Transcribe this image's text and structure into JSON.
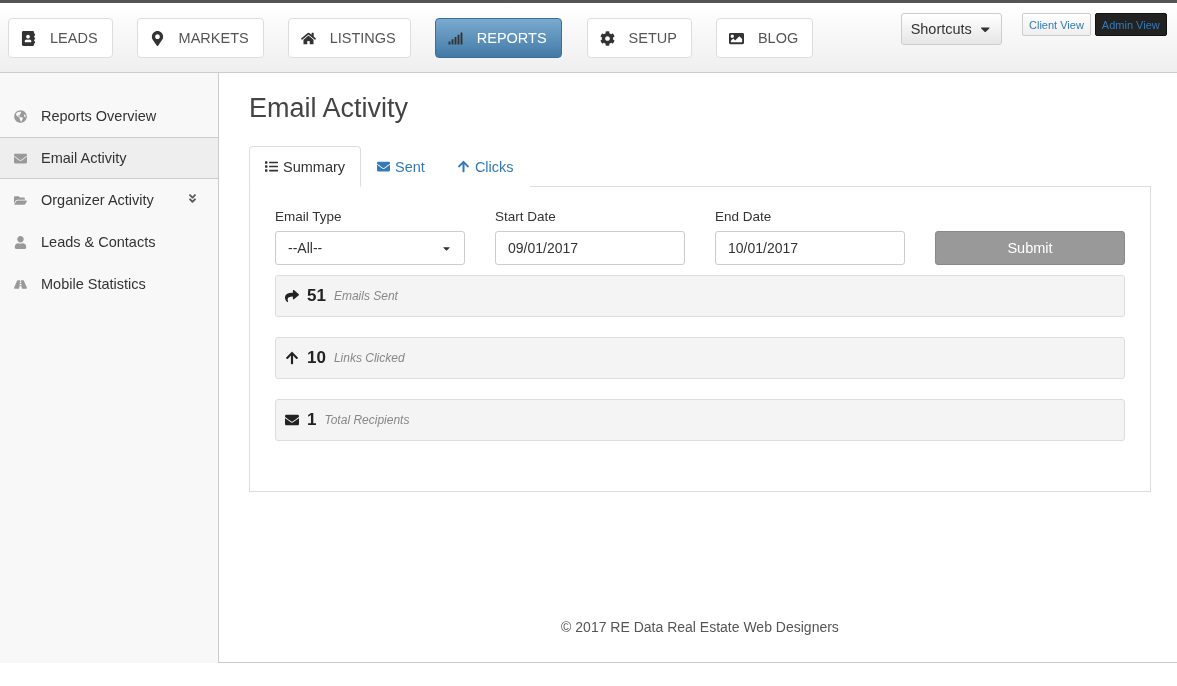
{
  "nav": [
    {
      "label": "LEADS",
      "selected": false
    },
    {
      "label": "MARKETS",
      "selected": false
    },
    {
      "label": "LISTINGS",
      "selected": false
    },
    {
      "label": "REPORTS",
      "selected": true
    },
    {
      "label": "SETUP",
      "selected": false
    },
    {
      "label": "BLOG",
      "selected": false
    }
  ],
  "shortcuts": "Shortcuts",
  "views": [
    {
      "label": "Client View",
      "selected": false
    },
    {
      "label": "Admin View",
      "selected": true
    }
  ],
  "sidebar": {
    "items": [
      {
        "label": "Reports Overview",
        "selected": false,
        "expandable": false
      },
      {
        "label": "Email Activity",
        "selected": true,
        "expandable": false
      },
      {
        "label": "Organizer Activity",
        "selected": false,
        "expandable": true
      },
      {
        "label": "Leads & Contacts",
        "selected": false,
        "expandable": false
      },
      {
        "label": "Mobile Statistics",
        "selected": false,
        "expandable": false
      }
    ]
  },
  "page_title": "Email Activity",
  "tabs": [
    {
      "label": "Summary",
      "selected": true
    },
    {
      "label": "Sent",
      "selected": false
    },
    {
      "label": "Clicks",
      "selected": false
    }
  ],
  "form": {
    "email_type": {
      "label": "Email Type",
      "value": "--All--"
    },
    "start_date": {
      "label": "Start Date",
      "value": "09/01/2017"
    },
    "end_date": {
      "label": "End Date",
      "value": "10/01/2017"
    },
    "submit": "Submit"
  },
  "stats": [
    {
      "value": "51",
      "label": "Emails Sent"
    },
    {
      "value": "10",
      "label": "Links Clicked"
    },
    {
      "value": "1",
      "label": "Total Recipients"
    }
  ],
  "footer": "© 2017 RE Data Real Estate Web Designers"
}
